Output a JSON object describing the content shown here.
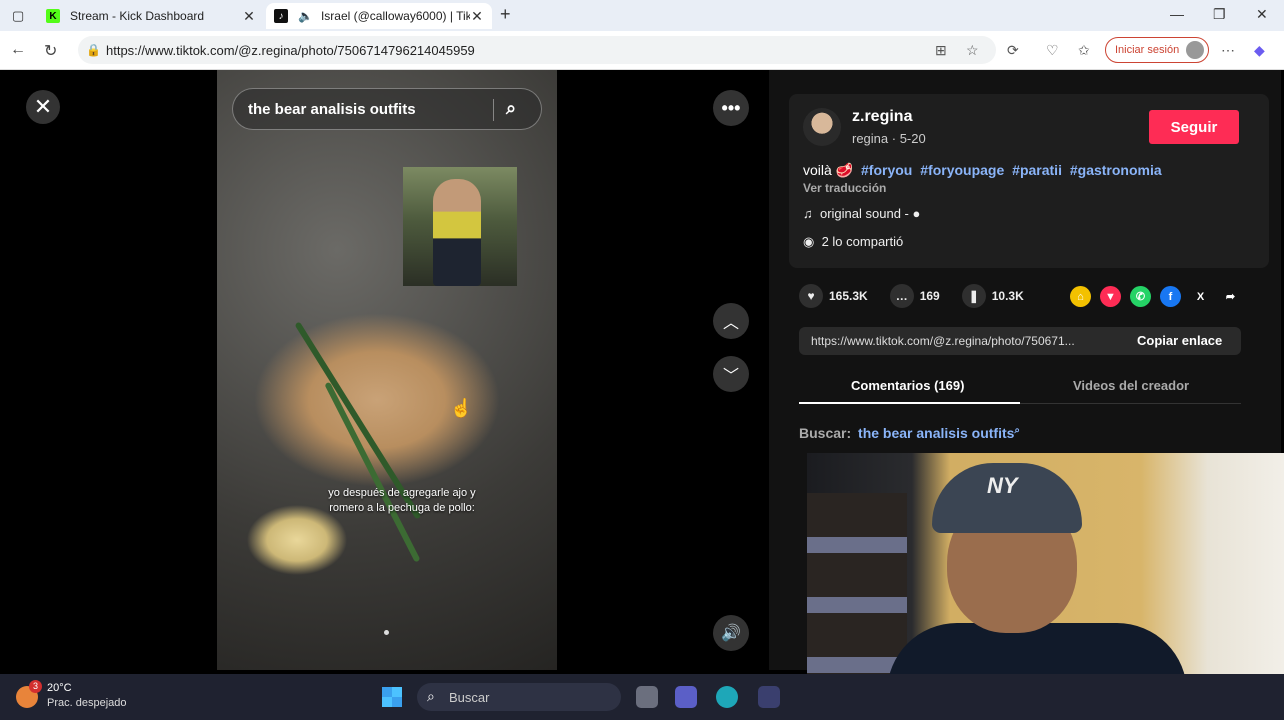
{
  "browser": {
    "tabs": [
      {
        "title": "Stream - Kick Dashboard"
      },
      {
        "title": "Israel (@calloway6000) | TikT"
      }
    ],
    "url": "https://www.tiktok.com/@z.regina/photo/7506714796214045959",
    "signin_label": "Iniciar sesión"
  },
  "viewer": {
    "search_query": "the bear analisis outfits",
    "caption": "yo después de agregarle ajo y romero a la pechuga de pollo:"
  },
  "post": {
    "username": "z.regina",
    "meta": "regina · 5-20",
    "follow_label": "Seguir",
    "description": "voilà 🥩",
    "hashtags": [
      "#foryou",
      "#foryoupage",
      "#paratii",
      "#gastronomia"
    ],
    "translate_label": "Ver traducción",
    "sound": "original sound - ●",
    "shared": "2 lo compartió",
    "likes": "165.3K",
    "comments": "169",
    "saves": "10.3K",
    "link": "https://www.tiktok.com/@z.regina/photo/750671...",
    "copy_label": "Copiar enlace",
    "tab_comments": "Comentarios (169)",
    "tab_videos": "Videos del creador",
    "search_prefix": "Buscar:",
    "search_suggestion": "the bear analisis outfits"
  },
  "webcam": {
    "cap_logo": "NY"
  },
  "taskbar": {
    "weather_temp": "20°C",
    "weather_cond": "Prac. despejado",
    "weather_badge": "3",
    "search_placeholder": "Buscar"
  },
  "colors": {
    "accent": "#fe2c55",
    "link": "#8ab4f8"
  }
}
